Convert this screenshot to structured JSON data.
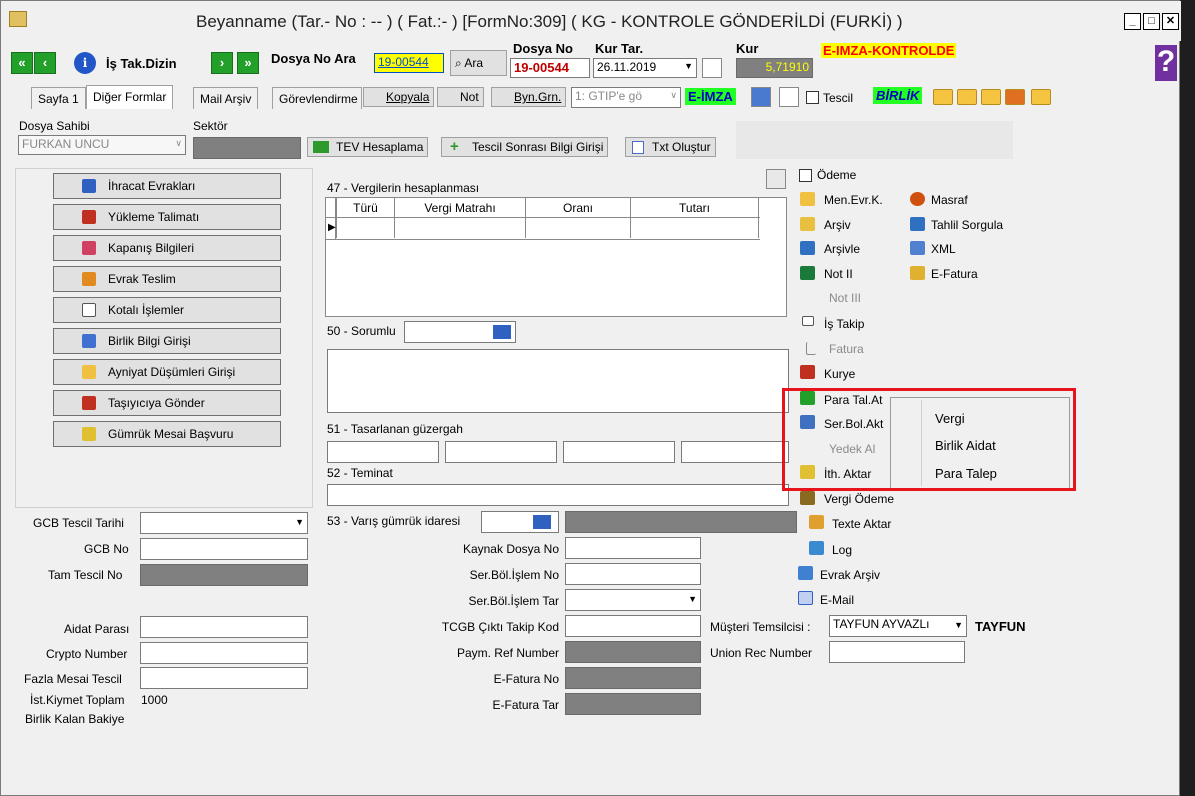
{
  "window": {
    "title": "Beyanname (Tar.- No : -- ) ( Fat.:- ) [FormNo:309] ( KG - KONTROLE GÖNDERİLDİ (FURKİ) )"
  },
  "toolbar": {
    "is_tak_dizin": "İş Tak.Dizin",
    "dosya_no_ara_label": "Dosya No Ara",
    "dosya_no_ara_value": "19-00544",
    "ara_button": "Ara",
    "dosya_no_label": "Dosya No",
    "dosya_no_value": "19-00544",
    "kur_tar_label": "Kur Tar.",
    "kur_tar_value": "26.11.2019",
    "kur_label": "Kur",
    "kur_value": "5,71910",
    "eimza_status": "E-IMZA-KONTROLDE"
  },
  "tabs": {
    "sayfa1": "Sayfa 1",
    "diger_formlar": "Diğer Formlar",
    "mail_arsiv": "Mail Arşiv",
    "gorevlendirme": "Görevlendirme",
    "kopyala": "Kopyala",
    "not": "Not",
    "byn_grn": "Byn.Grn.",
    "gtip": "1: GTIP'e gö",
    "eimza": "E-İMZA",
    "tescil": "Tescil",
    "birlik": "BİRLİK"
  },
  "header2": {
    "dosya_sahibi_label": "Dosya Sahibi",
    "dosya_sahibi_value": "FURKAN UNCU",
    "sektor_label": "Sektör",
    "tev_button": "TEV Hesaplama",
    "tescil_sonrasi_button": "Tescil Sonrası Bilgi Girişi",
    "txt_button": "Txt Oluştur"
  },
  "left_buttons": [
    "İhracat Evrakları",
    "Yükleme Talimatı",
    "Kapanış Bilgileri",
    "Evrak Teslim",
    "Kotalı İşlemler",
    "Birlik Bilgi Girişi",
    "Ayniyat Düşümleri Girişi",
    "Taşıyıcıya Gönder",
    "Gümrük Mesai Başvuru"
  ],
  "section47": {
    "title": "47 - Vergilerin hesaplanması",
    "columns": [
      "Türü",
      "Vergi Matrahı",
      "Oranı",
      "Tutarı"
    ]
  },
  "section50": {
    "label": "50 - Sorumlu"
  },
  "section51": {
    "label": "51 - Tasarlanan güzergah"
  },
  "section52": {
    "label": "52 - Teminat"
  },
  "section53": {
    "label": "53 - Varış gümrük idaresi"
  },
  "left_fields": {
    "gcb_tescil_tarihi": "GCB Tescil Tarihi",
    "gcb_no": "GCB No",
    "tam_tescil_no": "Tam Tescil No",
    "aidat_parasi": "Aidat Parası",
    "crypto_number": "Crypto Number",
    "fazla_mesai_tescil": "Fazla Mesai Tescil",
    "ist_kiymet_toplam": "İst.Kiymet Toplam",
    "ist_kiymet_value": "1000",
    "birlik_kalan_bakiye": "Birlik Kalan Bakiye"
  },
  "middle_fields": {
    "kaynak_dosya_no": "Kaynak Dosya No",
    "ser_bol_islem_no": "Ser.Böl.İşlem No",
    "ser_bol_islem_tar": "Ser.Böl.İşlem Tar",
    "tcgb_cikti_takip_kod": "TCGB Çıktı Takip Kod",
    "paym_ref_number": "Paym. Ref Number",
    "efatura_no": "E-Fatura No",
    "efatura_tar": "E-Fatura Tar"
  },
  "right_fields": {
    "musteri_temsilcisi": "Müşteri Temsilcisi :",
    "musteri_temsilcisi_value": "TAYFUN AYVAZLı",
    "musteri_short": "TAYFUN",
    "union_rec_number": "Union Rec Number"
  },
  "right_menu": {
    "odeme": "Ödeme",
    "men_evr_k": "Men.Evr.K.",
    "masraf": "Masraf",
    "arsiv": "Arşiv",
    "tahlil_sorgula": "Tahlil Sorgula",
    "arsivle": "Arşivle",
    "xml": "XML",
    "not_ii": "Not II",
    "efatura": "E-Fatura",
    "not_iii": "Not III",
    "is_takip": "İş Takip",
    "fatura": "Fatura",
    "kurye": "Kurye",
    "para_tal_at": "Para Tal.At",
    "ser_bol_akt": "Ser.Bol.Akt",
    "yedek_al": "Yedek Al",
    "ith_aktar": "İth. Aktar",
    "vergi_odeme": "Vergi Ödeme",
    "texte_aktar": "Texte Aktar",
    "log": "Log",
    "evrak_arsiv": "Evrak Arşiv",
    "email": "E-Mail"
  },
  "context_menu": {
    "items": [
      "Vergi",
      "Birlik Aidat",
      "Para Talep"
    ]
  },
  "colors": {
    "highlight_box": "#e8141c",
    "nav_green": "#22a02a",
    "eimza_red": "#ff0000",
    "eimza_yellow": "#ffff00"
  }
}
